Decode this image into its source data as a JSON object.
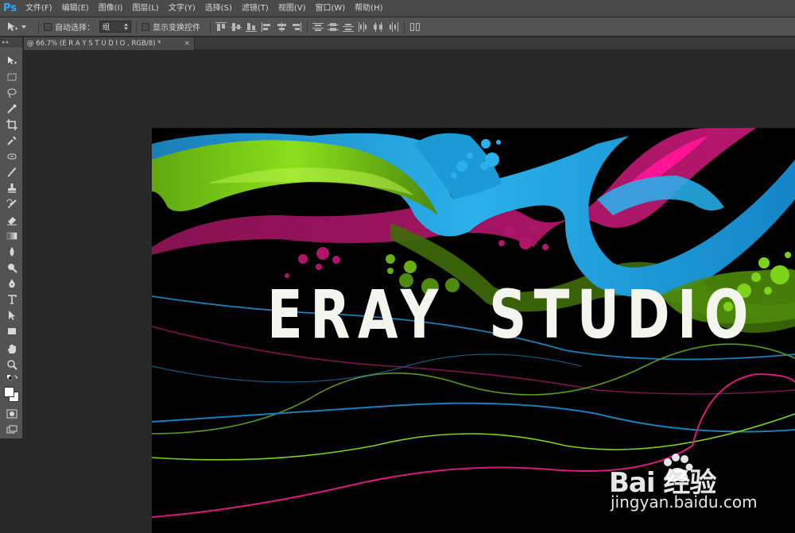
{
  "app": {
    "logo": "Ps"
  },
  "menu": [
    {
      "label": "文件(F)"
    },
    {
      "label": "编辑(E)"
    },
    {
      "label": "图像(I)"
    },
    {
      "label": "图层(L)"
    },
    {
      "label": "文字(Y)"
    },
    {
      "label": "选择(S)"
    },
    {
      "label": "滤镜(T)"
    },
    {
      "label": "视图(V)"
    },
    {
      "label": "窗口(W)"
    },
    {
      "label": "帮助(H)"
    }
  ],
  "options": {
    "auto_select_label": "自动选择：",
    "auto_select_value": "组",
    "show_transform_label": "显示变换控件"
  },
  "document": {
    "tab_title": "@ 66.7% (E R A Y      S T U D I O , RGB/8) *",
    "close": "×"
  },
  "artwork": {
    "headline_left": "ERAY",
    "headline_right": "STUDIO"
  },
  "watermark": {
    "logo": "Bai  经验",
    "url": "jingyan.baidu.com"
  },
  "colors": {
    "accent_blue": "#1aa3e0",
    "accent_green": "#7ed21a",
    "accent_magenta": "#d8197f"
  }
}
